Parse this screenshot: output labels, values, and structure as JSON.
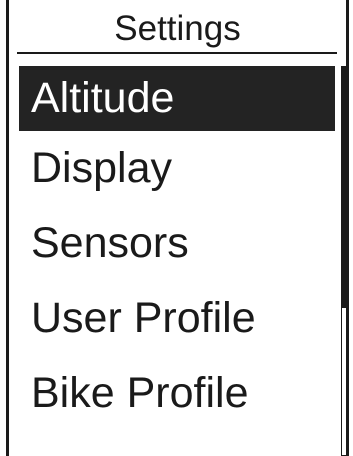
{
  "header": {
    "title": "Settings"
  },
  "menu": {
    "items": [
      {
        "label": "Altitude",
        "selected": true
      },
      {
        "label": "Display",
        "selected": false
      },
      {
        "label": "Sensors",
        "selected": false
      },
      {
        "label": "User Profile",
        "selected": false
      },
      {
        "label": "Bike Profile",
        "selected": false
      }
    ]
  },
  "scrollbar": {
    "position_fraction": 0.0,
    "visible_fraction": 0.62
  },
  "colors": {
    "foreground": "#1a1a1a",
    "selection_background": "#232323",
    "selection_text": "#ffffff",
    "background": "#ffffff"
  }
}
